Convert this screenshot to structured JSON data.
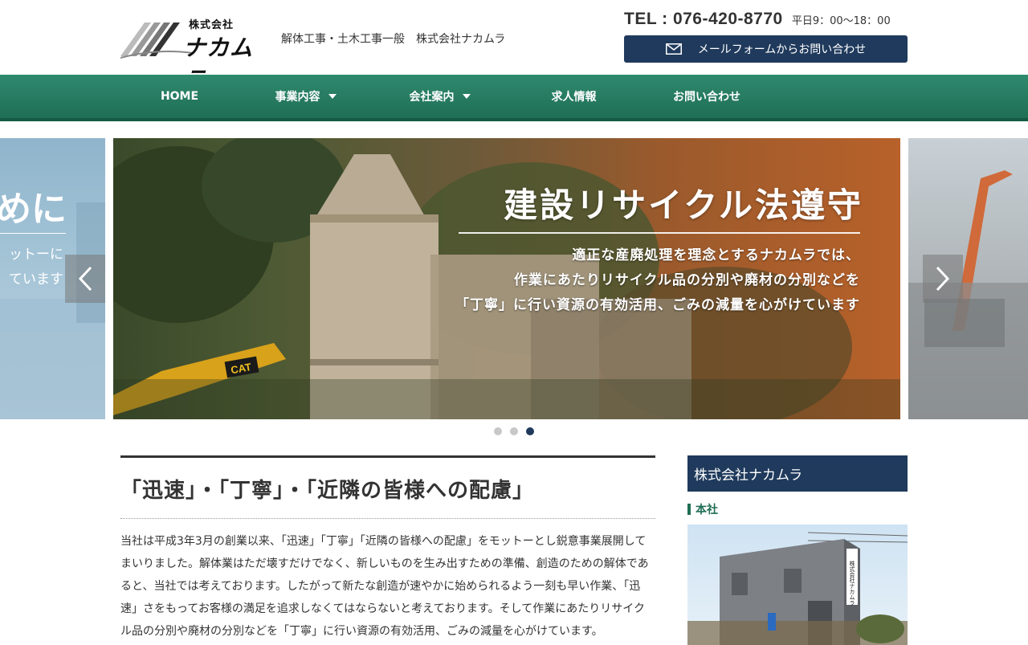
{
  "header": {
    "logo_small": "株式会社",
    "logo_main": "ナカムラ",
    "tagline": "解体工事・土木工事一般　株式会社ナカムラ",
    "tel": "TEL : 076-420-8770",
    "hours": "平日9：00〜18：00",
    "mail_button": "メールフォームからお問い合わせ"
  },
  "nav": {
    "items": [
      {
        "label": "HOME"
      },
      {
        "label": "事業内容"
      },
      {
        "label": "会社案内"
      },
      {
        "label": "求人情報"
      },
      {
        "label": "お問い合わせ"
      }
    ]
  },
  "slider": {
    "prev": {
      "title": "めに",
      "line1": "ットーに",
      "line2": "ています"
    },
    "current": {
      "title": "建設リサイクル法遵守",
      "line1": "適正な産廃処理を理念とするナカムラでは、",
      "line2": "作業にあたりリサイクル品の分別や廃材の分別などを",
      "line3": "「丁寧」に行い資源の有効活用、ごみの減量を心がけています"
    },
    "machine_label": "CAT",
    "active_dot": 3
  },
  "main": {
    "heading": "「迅速」・「丁寧」・「近隣の皆様への配慮」",
    "body": "当社は平成3年3月の創業以来、「迅速」「丁寧」「近隣の皆様への配慮」をモットーとし鋭意事業展開してまいりました。解体業はただ壊すだけでなく、新しいものを生み出すための準備、創造のための解体であると、当社では考えております。したがって新たな創造が速やかに始められるよう一刻も早い作業、「迅速」さをもってお客様の満足を追求しなくてはならないと考えております。そして作業にあたりリサイクル品の分別や廃材の分別などを「丁寧」に行い資源の有効活用、ごみの減量を心がけています。"
  },
  "sidebar": {
    "heading": "株式会社ナカムラ",
    "subheading": "本社",
    "sign_text": "株式会社ナカムラ"
  },
  "colors": {
    "navy": "#1f3a5c",
    "green": "#1f6e55"
  }
}
